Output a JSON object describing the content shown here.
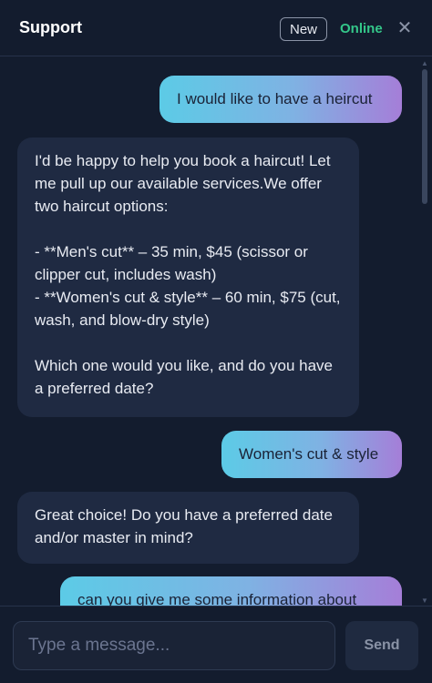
{
  "header": {
    "title": "Support",
    "new_label": "New",
    "status": "Online",
    "close_glyph": "✕"
  },
  "messages": [
    {
      "role": "user",
      "text": "I would like to have a heircut"
    },
    {
      "role": "assistant",
      "text": "I'd be happy to help you book a haircut! Let me pull up our available services.We offer two haircut options:\n\n- **Men's cut** – 35 min, $45 (scissor or clipper cut, includes wash)\n- **Women's cut & style** – 60 min, $75 (cut, wash, and blow-dry style)\n\nWhich one would you like, and do you have a preferred date?"
    },
    {
      "role": "user",
      "text": "Women's cut & style"
    },
    {
      "role": "assistant",
      "text": "Great choice! Do you have a preferred date and/or master in mind?"
    },
    {
      "role": "user",
      "text": "can you give me some information about"
    }
  ],
  "composer": {
    "placeholder": "Type a message...",
    "value": "",
    "send_label": "Send"
  },
  "colors": {
    "background": "#131c2e",
    "assistant_bubble": "#1f2a42",
    "user_gradient_start": "#5ccbe6",
    "user_gradient_end": "#a57ed8",
    "status_online": "#34c78a"
  },
  "icons": [
    "close-icon",
    "scroll-up-arrow-icon",
    "scroll-down-arrow-icon"
  ]
}
